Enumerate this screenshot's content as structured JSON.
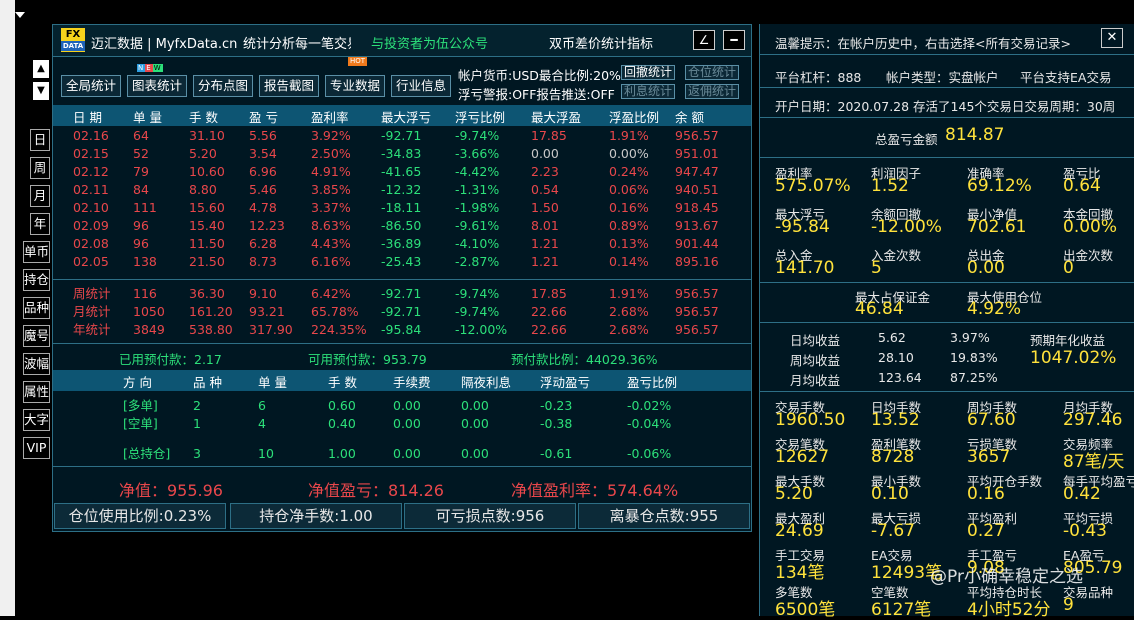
{
  "header": {
    "brand": "迈汇数据 | MyfxData.cn",
    "slogan": "统计分析每一笔交易",
    "promo": "与投资者为伍公众号",
    "mode": "双币差价统计指标",
    "logo_top": "FX",
    "logo_bottom": "DATA"
  },
  "toolbar": {
    "global": "全局统计",
    "chart": "图表统计",
    "dist": "分布点图",
    "report": "报告截图",
    "pro": "专业数据",
    "industry": "行业信息",
    "new_badge": "NEW",
    "hot_badge": "HOT"
  },
  "account_info": {
    "line1": "帐户货币:USD最合比例:20%",
    "line2": "浮亏警报:OFF报告推送:OFF",
    "chip1": "回撤统计",
    "chip2": "仓位统计",
    "chip3": "利息统计",
    "chip4": "返佣统计"
  },
  "columns": [
    "日 期",
    "单 量",
    "手 数",
    "盈 亏",
    "盈利率",
    "最大浮亏",
    "浮亏比例",
    "最大浮盈",
    "浮盈比例",
    "余 额"
  ],
  "rows": [
    [
      "02.16",
      "64",
      "31.10",
      "5.56",
      "3.92%",
      "-92.71",
      "-9.74%",
      "17.85",
      "1.91%",
      "956.57"
    ],
    [
      "02.15",
      "52",
      "5.20",
      "3.54",
      "2.50%",
      "-34.83",
      "-3.66%",
      "0.00",
      "0.00%",
      "951.01"
    ],
    [
      "02.12",
      "79",
      "10.60",
      "6.96",
      "4.91%",
      "-41.65",
      "-4.42%",
      "2.23",
      "0.24%",
      "947.47"
    ],
    [
      "02.11",
      "84",
      "8.80",
      "5.46",
      "3.85%",
      "-12.32",
      "-1.31%",
      "0.54",
      "0.06%",
      "940.51"
    ],
    [
      "02.10",
      "111",
      "15.60",
      "4.78",
      "3.37%",
      "-18.11",
      "-1.98%",
      "1.50",
      "0.16%",
      "918.45"
    ],
    [
      "02.09",
      "96",
      "15.40",
      "12.23",
      "8.63%",
      "-86.50",
      "-9.61%",
      "8.01",
      "0.89%",
      "913.67"
    ],
    [
      "02.08",
      "96",
      "11.50",
      "6.28",
      "4.43%",
      "-36.89",
      "-4.10%",
      "1.21",
      "0.13%",
      "901.44"
    ],
    [
      "02.05",
      "138",
      "21.50",
      "8.73",
      "6.16%",
      "-25.43",
      "-2.87%",
      "1.21",
      "0.14%",
      "895.16"
    ]
  ],
  "summary_rows": [
    [
      "周统计",
      "116",
      "36.30",
      "9.10",
      "6.42%",
      "-92.71",
      "-9.74%",
      "17.85",
      "1.91%",
      "956.57"
    ],
    [
      "月统计",
      "1050",
      "161.20",
      "93.21",
      "65.78%",
      "-92.71",
      "-9.74%",
      "22.66",
      "2.68%",
      "956.57"
    ],
    [
      "年统计",
      "3849",
      "538.80",
      "317.90",
      "224.35%",
      "-95.84",
      "-12.00%",
      "22.66",
      "2.68%",
      "956.57"
    ]
  ],
  "prepay": {
    "used": "已用预付款：2.17",
    "available": "可用预付款：953.79",
    "ratio": "预付款比例：44029.36%"
  },
  "position_columns": [
    "方 向",
    "品 种",
    "单 量",
    "手 数",
    "手续费",
    "隔夜利息",
    "浮动盈亏",
    "盈亏比例"
  ],
  "positions": [
    [
      "[多单]",
      "2",
      "6",
      "0.60",
      "0.00",
      "0.00",
      "-0.23",
      "-0.02%"
    ],
    [
      "[空单]",
      "1",
      "4",
      "0.40",
      "0.00",
      "0.00",
      "-0.38",
      "-0.04%"
    ],
    [
      "[总持仓]",
      "3",
      "10",
      "1.00",
      "0.00",
      "0.00",
      "-0.61",
      "-0.06%"
    ]
  ],
  "net": {
    "value": "净值：955.96",
    "profit": "净值盈亏：814.26",
    "rate": "净值盈利率：574.64%"
  },
  "bottom_buttons": [
    "仓位使用比例:0.23%",
    "持仓净手数:1.00",
    "可亏损点数:956",
    "离暴仓点数:955"
  ],
  "side_tabs": [
    "日",
    "周",
    "月",
    "年",
    "单币",
    "持仓",
    "品种",
    "魔号",
    "波幅",
    "属性",
    "大字",
    "VIP"
  ],
  "scroll": {
    "up": "▲",
    "down": "▼"
  },
  "right": {
    "tip": "温馨提示：在帐户历史中，右击选择<所有交易记录>",
    "close": "✕",
    "leverage": "平台杠杆：888",
    "acct_type": "帐户类型：实盘帐户",
    "ea": "平台支持EA交易",
    "open_line": "开户日期：2020.07.28 存活了145个交易日交易周期：30周",
    "total_label": "总盈亏金额",
    "total_value": "814.87",
    "grid1": [
      [
        "盈利率",
        "575.07%"
      ],
      [
        "利润因子",
        "1.52"
      ],
      [
        "准确率",
        "69.12%"
      ],
      [
        "盈亏比",
        "0.64"
      ],
      [
        "最大浮亏",
        "-95.84"
      ],
      [
        "余额回撤",
        "-12.00%"
      ],
      [
        "最小净值",
        "702.61"
      ],
      [
        "本金回撤",
        "0.00%"
      ],
      [
        "总入金",
        "141.70"
      ],
      [
        "入金次数",
        "5"
      ],
      [
        "总出金",
        "0.00"
      ],
      [
        "出金次数",
        "0"
      ]
    ],
    "margin": [
      [
        "最大占保证金",
        "46.84"
      ],
      [
        "最大使用仓位",
        "4.92%"
      ]
    ],
    "daily": [
      [
        "日均收益",
        "5.62",
        "3.97%"
      ],
      [
        "周均收益",
        "28.10",
        "19.83%"
      ],
      [
        "月均收益",
        "123.64",
        "87.25%"
      ]
    ],
    "annual_label": "预期年化收益",
    "annual_value": "1047.02%",
    "grid2": [
      [
        "交易手数",
        "1960.50"
      ],
      [
        "日均手数",
        "13.52"
      ],
      [
        "周均手数",
        "67.60"
      ],
      [
        "月均手数",
        "297.46"
      ],
      [
        "交易笔数",
        "12627"
      ],
      [
        "盈利笔数",
        "8728"
      ],
      [
        "亏损笔数",
        "3657"
      ],
      [
        "交易频率",
        "87笔/天"
      ],
      [
        "最大手数",
        "5.20"
      ],
      [
        "最小手数",
        "0.10"
      ],
      [
        "平均开仓手数",
        "0.16"
      ],
      [
        "每手平均盈亏",
        "0.42"
      ],
      [
        "最大盈利",
        "24.69"
      ],
      [
        "最大亏损",
        "-7.67"
      ],
      [
        "平均盈利",
        "0.27"
      ],
      [
        "平均亏损",
        "-0.43"
      ],
      [
        "手工交易",
        "134笔"
      ],
      [
        "EA交易",
        "12493笔"
      ],
      [
        "手工盈亏",
        "9.08"
      ],
      [
        "EA盈亏",
        "805.79"
      ],
      [
        "多笔数",
        "6500笔"
      ],
      [
        "空笔数",
        "6127笔"
      ],
      [
        "平均持仓时长",
        "4小时52分"
      ],
      [
        "交易品种",
        "9"
      ]
    ],
    "watermark": "@Pr小确幸稳定之选"
  }
}
